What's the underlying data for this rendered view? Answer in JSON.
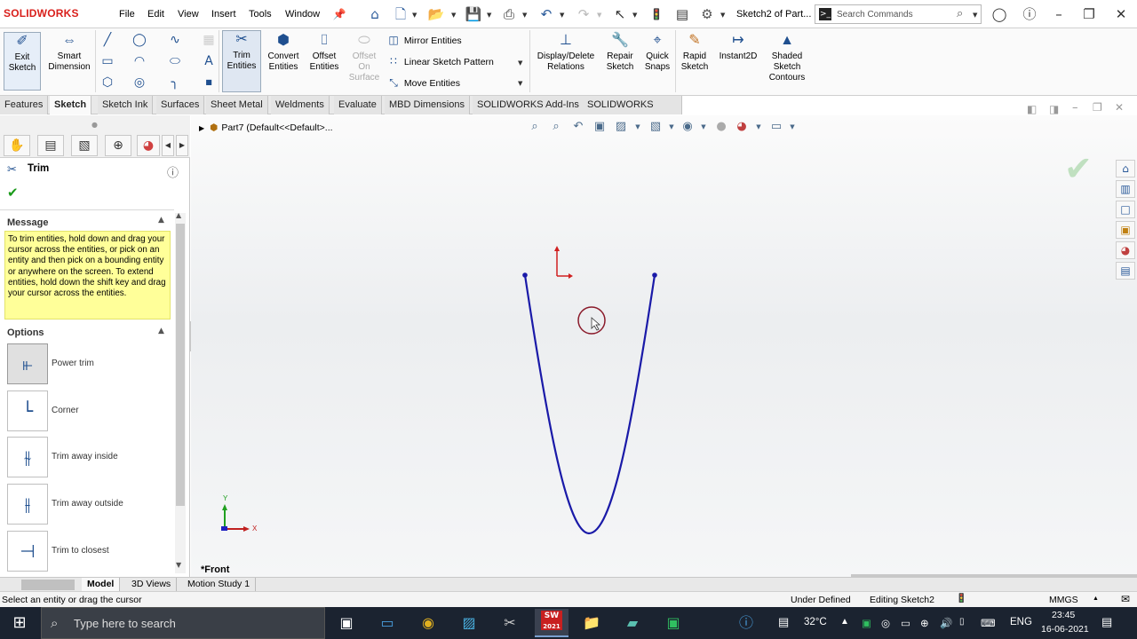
{
  "app": {
    "logo_text": "SOLIDWORKS",
    "document_title": "Sketch2 of Part...",
    "menus": [
      "File",
      "Edit",
      "View",
      "Insert",
      "Tools",
      "Window"
    ],
    "search_placeholder": "Search Commands"
  },
  "command_manager": {
    "exit_sketch": "Exit Sketch",
    "smart_dimension": "Smart Dimension",
    "trim_entities": "Trim Entities",
    "convert_entities": "Convert Entities",
    "offset_entities": "Offset Entities",
    "offset_on_surface": "Offset On Surface",
    "mirror_entities": "Mirror Entities",
    "linear_sketch_pattern": "Linear Sketch Pattern",
    "move_entities": "Move Entities",
    "display_delete_relations": "Display/Delete Relations",
    "repair_sketch": "Repair Sketch",
    "quick_snaps": "Quick Snaps",
    "rapid_sketch": "Rapid Sketch",
    "instant2d": "Instant2D",
    "shaded_sketch_contours": "Shaded Sketch Contours"
  },
  "tabs": [
    "Features",
    "Sketch",
    "Sketch Ink",
    "Surfaces",
    "Sheet Metal",
    "Weldments",
    "Evaluate",
    "MBD Dimensions",
    "SOLIDWORKS Add-Ins",
    "SOLIDWORKS CAM"
  ],
  "active_tab": "Sketch",
  "property_manager": {
    "title": "Trim",
    "message_header": "Message",
    "message_text": "To trim entities, hold down and drag your cursor across the entities, or pick on an entity and then pick on a bounding entity or anywhere on the screen.  To extend entities, hold down the shift key and drag your cursor across the entities.",
    "options_header": "Options",
    "options": [
      "Power trim",
      "Corner",
      "Trim away inside",
      "Trim away outside",
      "Trim to closest"
    ],
    "selected_option": "Power trim"
  },
  "feature_tree": {
    "part_label": "Part7  (Default<<Default>..."
  },
  "viewport": {
    "view_name": "*Front",
    "triad_y": "Y",
    "triad_x": "X",
    "curve_color": "#1a1aa8",
    "origin_color": "#d02020"
  },
  "bottom_tabs": [
    "Model",
    "3D Views",
    "Motion Study 1"
  ],
  "active_bottom_tab": "Model",
  "status_bar": {
    "hint": "Select an entity or drag the cursor",
    "definition": "Under Defined",
    "editing": "Editing Sketch2",
    "units": "MMGS"
  },
  "taskbar": {
    "search_placeholder": "Type here to search",
    "temperature": "32°C",
    "language": "ENG",
    "time": "23:45",
    "date": "16-06-2021",
    "sw_badge": "2021"
  }
}
